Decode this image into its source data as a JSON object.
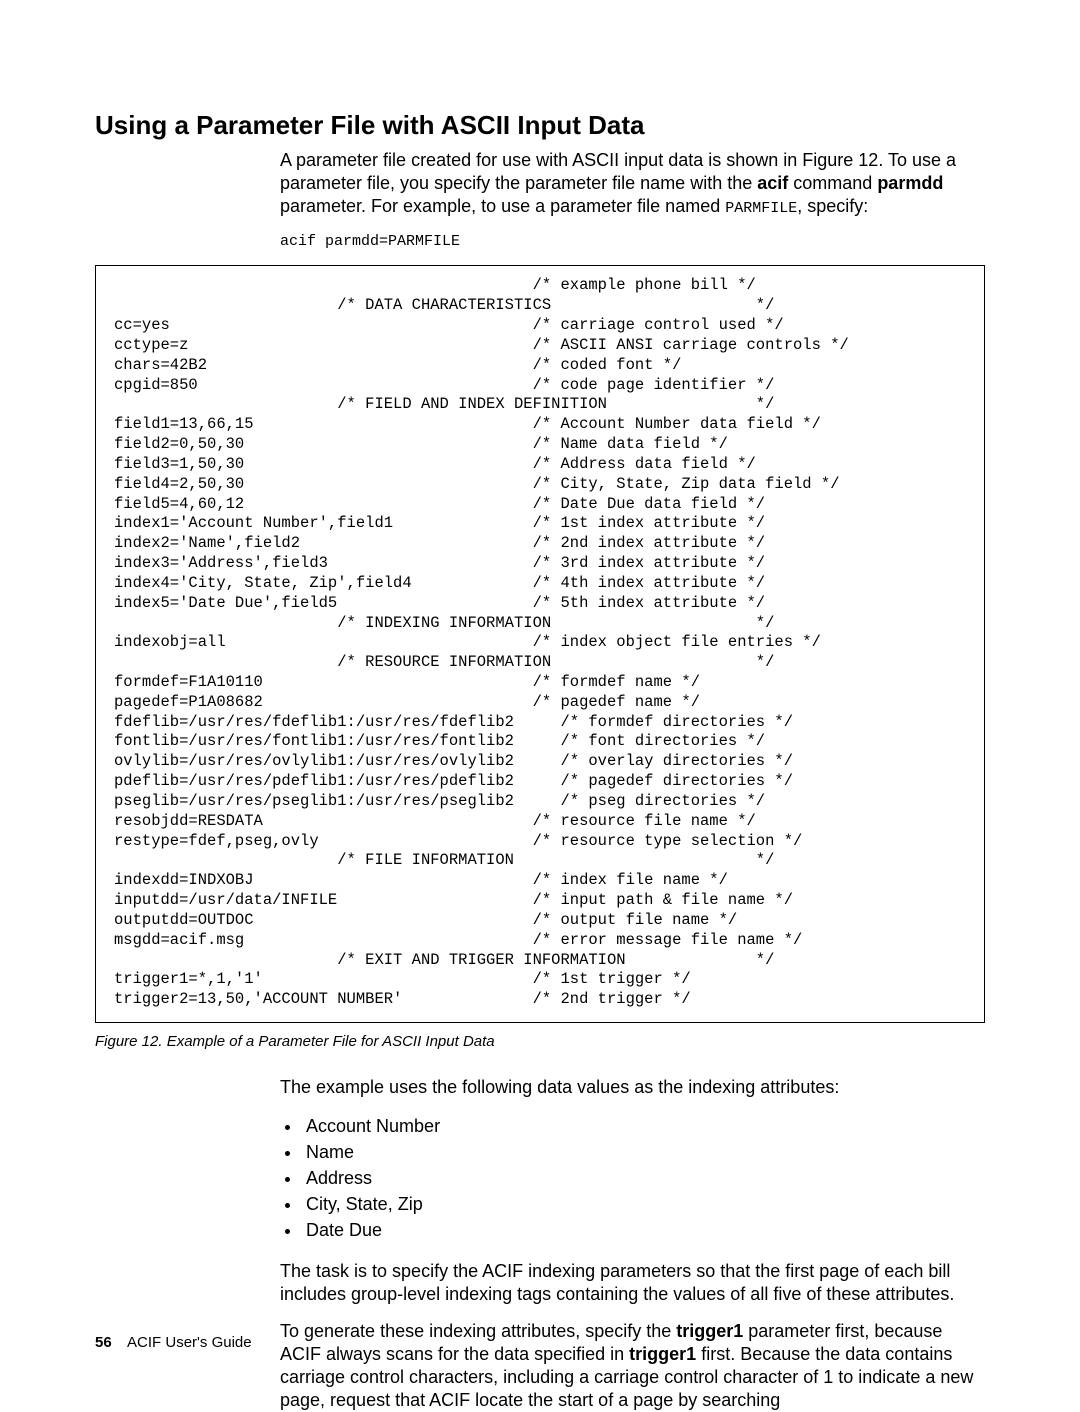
{
  "heading": "Using a Parameter File with ASCII Input Data",
  "intro": {
    "p1a": "A parameter file created for use with ASCII input data is shown in Figure 12. To use a parameter file, you specify the parameter file name with the ",
    "acif_bold": "acif",
    "p1b": " command ",
    "parmdd_bold": "parmdd",
    "p1c": " parameter. For example, to use a parameter file named ",
    "parmfile_mono": "PARMFILE",
    "p1d": ", specify:"
  },
  "cmd": "acif parmdd=PARMFILE",
  "code": "                                             /* example phone bill */\n                        /* DATA CHARACTERISTICS                      */\ncc=yes                                       /* carriage control used */\ncctype=z                                     /* ASCII ANSI carriage controls */\nchars=42B2                                   /* coded font */\ncpgid=850                                    /* code page identifier */\n                        /* FIELD AND INDEX DEFINITION                */\nfield1=13,66,15                              /* Account Number data field */\nfield2=0,50,30                               /* Name data field */\nfield3=1,50,30                               /* Address data field */\nfield4=2,50,30                               /* City, State, Zip data field */\nfield5=4,60,12                               /* Date Due data field */\nindex1='Account Number',field1               /* 1st index attribute */\nindex2='Name',field2                         /* 2nd index attribute */\nindex3='Address',field3                      /* 3rd index attribute */\nindex4='City, State, Zip',field4             /* 4th index attribute */\nindex5='Date Due',field5                     /* 5th index attribute */\n                        /* INDEXING INFORMATION                      */\nindexobj=all                                 /* index object file entries */\n                        /* RESOURCE INFORMATION                      */\nformdef=F1A10110                             /* formdef name */\npagedef=P1A08682                             /* pagedef name */\nfdeflib=/usr/res/fdeflib1:/usr/res/fdeflib2     /* formdef directories */\nfontlib=/usr/res/fontlib1:/usr/res/fontlib2     /* font directories */\novlylib=/usr/res/ovlylib1:/usr/res/ovlylib2     /* overlay directories */\npdeflib=/usr/res/pdeflib1:/usr/res/pdeflib2     /* pagedef directories */\npseglib=/usr/res/pseglib1:/usr/res/pseglib2     /* pseg directories */\nresobjdd=RESDATA                             /* resource file name */\nrestype=fdef,pseg,ovly                       /* resource type selection */\n                        /* FILE INFORMATION                          */\nindexdd=INDXOBJ                              /* index file name */\ninputdd=/usr/data/INFILE                     /* input path & file name */\noutputdd=OUTDOC                              /* output file name */\nmsgdd=acif.msg                               /* error message file name */\n                        /* EXIT AND TRIGGER INFORMATION              */\ntrigger1=*,1,'1'                             /* 1st trigger */\ntrigger2=13,50,'ACCOUNT NUMBER'              /* 2nd trigger */",
  "caption": "Figure 12. Example of a Parameter File for ASCII Input Data",
  "after": {
    "p1": "The example uses the following data values as the indexing attributes:",
    "bullets": [
      "Account Number",
      "Name",
      "Address",
      "City, State, Zip",
      "Date Due"
    ],
    "p2": "The task is to specify the ACIF indexing parameters so that the first page of each bill includes group-level indexing tags containing the values of all five of these attributes.",
    "p3a": "To generate these indexing attributes, specify the ",
    "trigger1a": "trigger1",
    "p3b": " parameter first, because ACIF always scans for the data specified in ",
    "trigger1b": "trigger1",
    "p3c": " first. Because the data contains carriage control characters, including a carriage control character of 1 to indicate a new page, request that ACIF locate the start of a page by searching"
  },
  "footer": {
    "page": "56",
    "title": "ACIF User's Guide"
  }
}
